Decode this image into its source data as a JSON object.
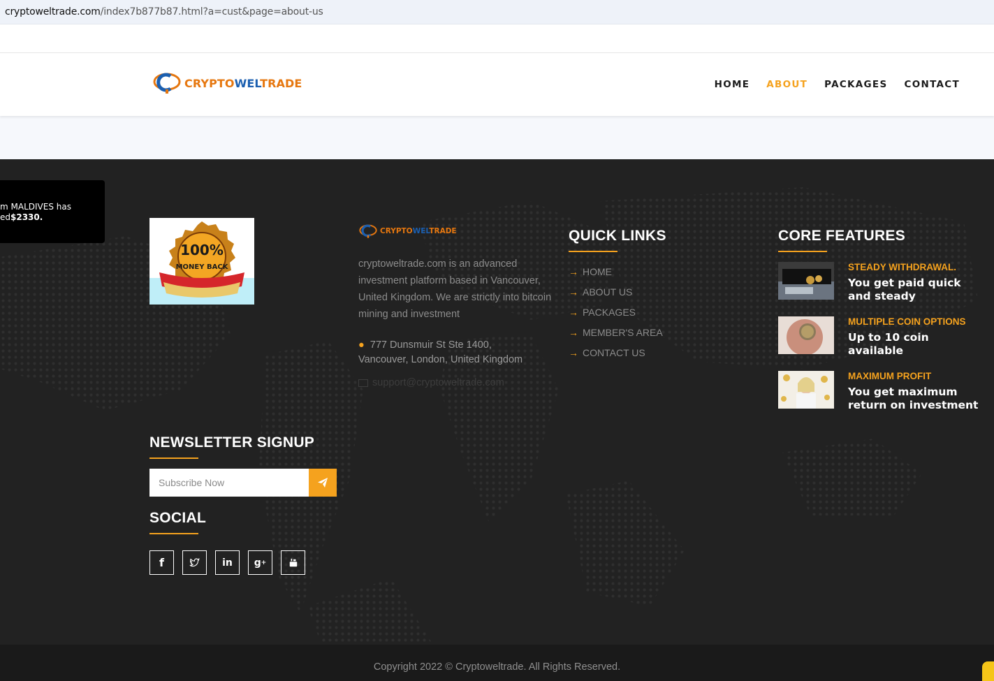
{
  "browser": {
    "url_host": "cryptoweltrade.com",
    "url_path": "/index7b877b87.html?a=cust&page=about-us"
  },
  "header": {
    "logo": {
      "part1": "CRYPTO",
      "part2": "WEL",
      "part3": "TRADE"
    },
    "nav": [
      {
        "label": "HOME",
        "active": false
      },
      {
        "label": "ABOUT",
        "active": true
      },
      {
        "label": "PACKAGES",
        "active": false
      },
      {
        "label": "CONTACT",
        "active": false
      }
    ]
  },
  "toast": {
    "text_prefix": "m MALDIVES has",
    "text_line2_prefix": "ed",
    "amount": "$2330."
  },
  "badge": {
    "percent": "100%",
    "text": "MONEY BACK"
  },
  "footer_about": {
    "logo": {
      "part1": "CRYPTO",
      "part2": "WEL",
      "part3": "TRADE"
    },
    "description": "cryptoweltrade.com is an advanced investment platform based in Vancouver, United Kingdom. We are strictly into bitcoin mining and investment",
    "address_line1": "777 Dunsmuir St Ste 1400,",
    "address_line2": "Vancouver, London, United Kingdom",
    "email": "support@cryptoweltrade.com"
  },
  "quick_links": {
    "title": "QUICK LINKS",
    "items": [
      "HOME",
      "ABOUT US",
      "PACKAGES",
      "MEMBER'S AREA",
      "CONTACT US"
    ]
  },
  "core_features": {
    "title": "CORE FEATURES",
    "items": [
      {
        "title": "STEADY WITHDRAWAL.",
        "desc": "You get paid quick and steady"
      },
      {
        "title": "MULTIPLE COIN OPTIONS",
        "desc": "Up to 10 coin available"
      },
      {
        "title": "MAXIMUM PROFIT",
        "desc": "You get maximum return on investment"
      }
    ]
  },
  "newsletter": {
    "title": "NEWSLETTER SIGNUP",
    "placeholder": "Subscribe Now"
  },
  "social": {
    "title": "SOCIAL",
    "icons": [
      "facebook-icon",
      "twitter-icon",
      "linkedin-icon",
      "google-plus-icon",
      "youtube-icon"
    ]
  },
  "copyright": "Copyright 2022 © Cryptoweltrade. All Rights Reserved.",
  "colors": {
    "accent": "#f5a21e",
    "footer_bg": "#222222",
    "logo_orange": "#e6770f",
    "logo_blue": "#1b5fb0"
  }
}
